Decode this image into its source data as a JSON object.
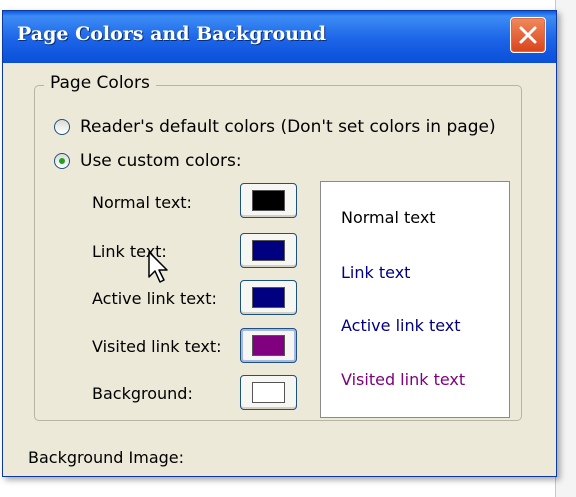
{
  "dialog": {
    "title": "Page Colors and Background"
  },
  "page_colors": {
    "group_title": "Page Colors",
    "options": [
      {
        "label": "Reader's default colors (Don't set colors in page)",
        "selected": false
      },
      {
        "label": "Use custom colors:",
        "selected": true
      }
    ],
    "color_items": [
      {
        "label": "Normal text:",
        "color": "#000000"
      },
      {
        "label": "Link text:",
        "color": "#000080"
      },
      {
        "label": "Active link text:",
        "color": "#000080"
      },
      {
        "label": "Visited link text:",
        "color": "#800080"
      },
      {
        "label": "Background:",
        "color": "#ffffff"
      }
    ]
  },
  "preview": {
    "normal": "Normal text",
    "link": "Link text",
    "active": "Active link text",
    "visited": "Visited link text"
  },
  "background_image": {
    "label": "Background Image:"
  }
}
